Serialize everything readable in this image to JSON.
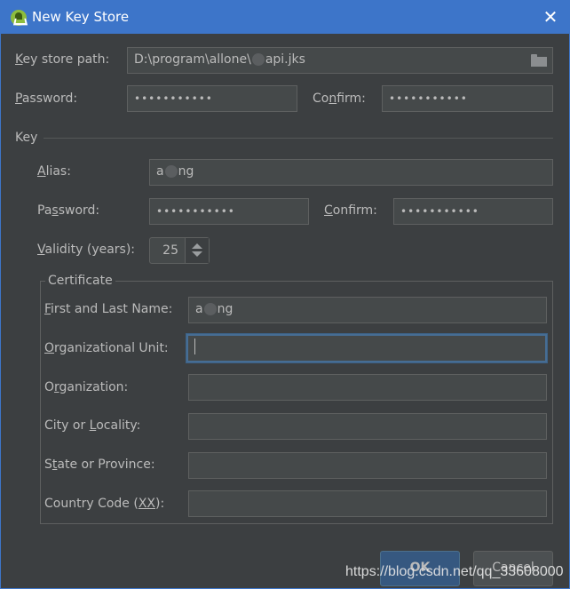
{
  "window": {
    "title": "New Key Store",
    "app_icon": "android-studio-icon",
    "close_icon": "close-icon"
  },
  "keystore": {
    "path_label_mnemonic": "K",
    "path_label_rest": "ey store path:",
    "path_value_prefix": "D:\\program\\allone\\",
    "path_value_suffix": "api.jks",
    "browse_icon": "folder-icon",
    "password_label_mnemonic": "P",
    "password_label_rest": "assword:",
    "password_value": "•••••••••••",
    "confirm_label_pre": "Co",
    "confirm_label_mnemonic": "n",
    "confirm_label_rest": "firm:",
    "confirm_value": "•••••••••••"
  },
  "key": {
    "section_title": "Key",
    "alias_label_mnemonic": "A",
    "alias_label_rest": "lias:",
    "alias_value_prefix": "a",
    "alias_value_suffix": "ng",
    "password_label_pre": "Pa",
    "password_label_mnemonic": "s",
    "password_label_rest": "sword:",
    "password_value": "•••••••••••",
    "confirm_label_mnemonic": "C",
    "confirm_label_rest": "onfirm:",
    "confirm_value": "•••••••••••",
    "validity_label_mnemonic": "V",
    "validity_label_rest": "alidity (years):",
    "validity_value": "25"
  },
  "certificate": {
    "title": "Certificate",
    "fields": [
      {
        "label_pre": "",
        "mnemonic": "F",
        "label_rest": "irst and Last Name:",
        "value_prefix": "a",
        "value_suffix": "ng",
        "focused": false
      },
      {
        "label_pre": "",
        "mnemonic": "O",
        "label_rest": "rganizational Unit:",
        "value": "",
        "focused": true
      },
      {
        "label_pre": "O",
        "mnemonic": "r",
        "label_rest": "ganization:",
        "value": "",
        "focused": false
      },
      {
        "label_pre": "City or ",
        "mnemonic": "L",
        "label_rest": "ocality:",
        "value": "",
        "focused": false
      },
      {
        "label_pre": "S",
        "mnemonic": "t",
        "label_rest": "ate or Province:",
        "value": "",
        "focused": false
      },
      {
        "label_pre": "Country Code (",
        "mnemonic": "XX",
        "label_rest": "):",
        "value": "",
        "focused": false
      }
    ]
  },
  "buttons": {
    "ok": "OK",
    "cancel": "Cancel"
  },
  "watermark": "https://blog.csdn.net/qq_33608000"
}
